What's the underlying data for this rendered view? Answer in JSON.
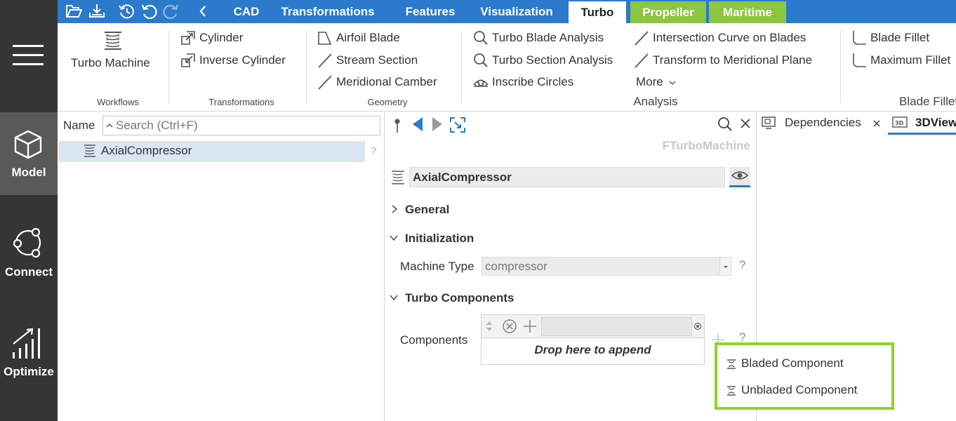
{
  "sidebar": {
    "items": [
      {
        "label": "Model",
        "icon": "cube-icon",
        "active": true
      },
      {
        "label": "Connect",
        "icon": "connect-nodes-icon",
        "active": false
      },
      {
        "label": "Optimize",
        "icon": "optimize-chart-icon",
        "active": false
      }
    ]
  },
  "tabs": {
    "items": [
      "CAD",
      "Transformations",
      "Features",
      "Visualization",
      "Turbo",
      "Propeller",
      "Maritime"
    ],
    "active": "Turbo"
  },
  "ribbon": {
    "workflows": {
      "turbo_machine": "Turbo Machine",
      "group": "Workflows"
    },
    "transformations": {
      "cylinder": "Cylinder",
      "inverse_cylinder": "Inverse Cylinder",
      "group": "Transformations"
    },
    "geometry": {
      "airfoil_blade": "Airfoil Blade",
      "stream_section": "Stream Section",
      "meridional_camber": "Meridional Camber",
      "group": "Geometry"
    },
    "analysis": {
      "turbo_blade_analysis": "Turbo Blade Analysis",
      "turbo_section_analysis": "Turbo Section Analysis",
      "inscribe_circles": "Inscribe Circles",
      "intersection_curve": "Intersection Curve on Blades",
      "transform_meridional": "Transform to Meridional Plane",
      "more": "More",
      "group": "Analysis"
    },
    "blade_fillet": {
      "blade_fillet": "Blade Fillet",
      "maximum_fillet": "Maximum Fillet",
      "group": "Blade Fillet"
    }
  },
  "tree": {
    "name_header": "Name",
    "search_placeholder": "Search (Ctrl+F)",
    "items": [
      {
        "label": "AxialCompressor",
        "help": "?"
      }
    ]
  },
  "props": {
    "type_label": "FTurboMachine",
    "object_name": "AxialCompressor",
    "sections": {
      "general": "General",
      "initialization": "Initialization",
      "turbo_components": "Turbo Components"
    },
    "machine_type": {
      "label": "Machine Type",
      "value": "compressor",
      "help": "?"
    },
    "components": {
      "label": "Components",
      "drop_text": "Drop here to append",
      "help": "?"
    }
  },
  "views": {
    "tabs": [
      {
        "label": "Dependencies",
        "icon": "dependencies-icon"
      },
      {
        "label": "3DView",
        "icon": "3d-view-icon"
      }
    ]
  },
  "popup": {
    "items": [
      "Bladed Component",
      "Unbladed Component"
    ]
  },
  "colors": {
    "accent_blue": "#2b7acb",
    "green_tab": "#8cc63f",
    "highlight_border": "#8cd32b",
    "sidebar": "#353535",
    "sidebar_active": "#595959",
    "tree_selection": "#dbe6f3"
  }
}
